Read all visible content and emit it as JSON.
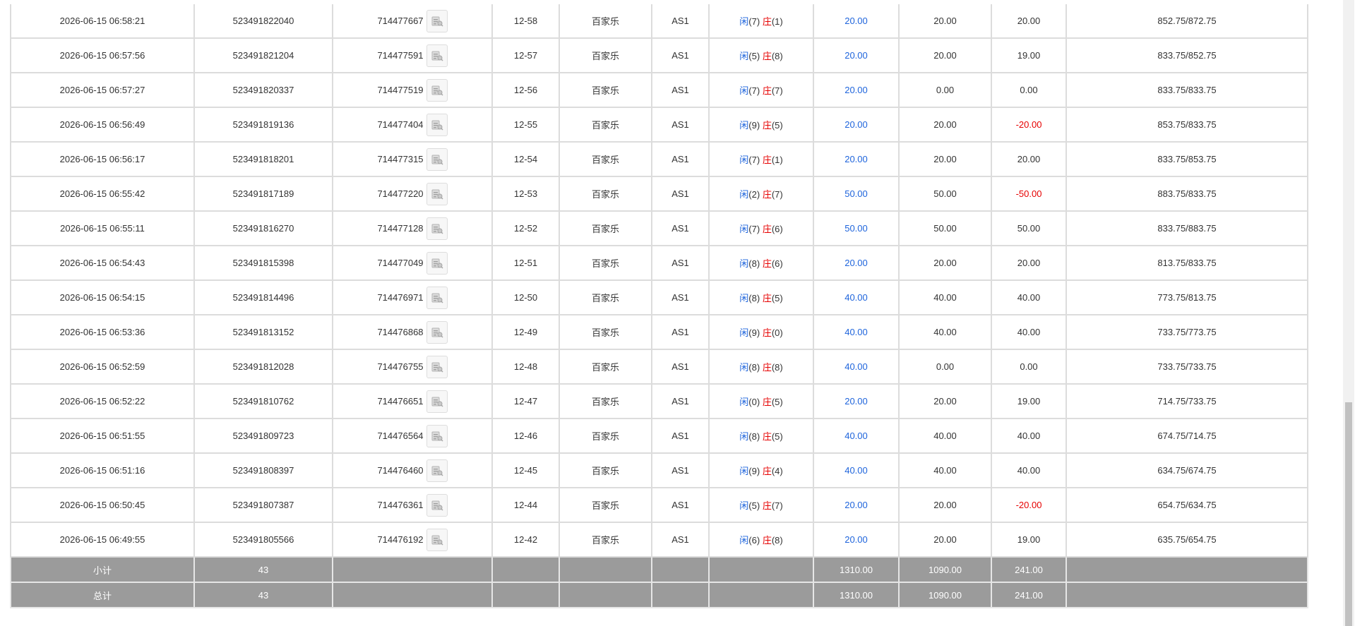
{
  "rows": [
    {
      "time": "2026-06-15 06:58:21",
      "order_no": "523491822040",
      "round_id": "714477667",
      "shoe": "12-58",
      "game": "百家乐",
      "table": "AS1",
      "result": {
        "player_label": "闲",
        "player_point": "(7)",
        "banker_label": "庄",
        "banker_point": "(1)"
      },
      "bet": "20.00",
      "valid_bet": "20.00",
      "win_loss": "20.00",
      "win_color": "normal",
      "balance": "852.75/872.75"
    },
    {
      "time": "2026-06-15 06:57:56",
      "order_no": "523491821204",
      "round_id": "714477591",
      "shoe": "12-57",
      "game": "百家乐",
      "table": "AS1",
      "result": {
        "player_label": "闲",
        "player_point": "(5)",
        "banker_label": "庄",
        "banker_point": "(8)"
      },
      "bet": "20.00",
      "valid_bet": "20.00",
      "win_loss": "19.00",
      "win_color": "normal",
      "balance": "833.75/852.75"
    },
    {
      "time": "2026-06-15 06:57:27",
      "order_no": "523491820337",
      "round_id": "714477519",
      "shoe": "12-56",
      "game": "百家乐",
      "table": "AS1",
      "result": {
        "player_label": "闲",
        "player_point": "(7)",
        "banker_label": "庄",
        "banker_point": "(7)"
      },
      "bet": "20.00",
      "valid_bet": "0.00",
      "win_loss": "0.00",
      "win_color": "normal",
      "balance": "833.75/833.75"
    },
    {
      "time": "2026-06-15 06:56:49",
      "order_no": "523491819136",
      "round_id": "714477404",
      "shoe": "12-55",
      "game": "百家乐",
      "table": "AS1",
      "result": {
        "player_label": "闲",
        "player_point": "(9)",
        "banker_label": "庄",
        "banker_point": "(5)"
      },
      "bet": "20.00",
      "valid_bet": "20.00",
      "win_loss": "-20.00",
      "win_color": "red",
      "balance": "853.75/833.75"
    },
    {
      "time": "2026-06-15 06:56:17",
      "order_no": "523491818201",
      "round_id": "714477315",
      "shoe": "12-54",
      "game": "百家乐",
      "table": "AS1",
      "result": {
        "player_label": "闲",
        "player_point": "(7)",
        "banker_label": "庄",
        "banker_point": "(1)"
      },
      "bet": "20.00",
      "valid_bet": "20.00",
      "win_loss": "20.00",
      "win_color": "normal",
      "balance": "833.75/853.75"
    },
    {
      "time": "2026-06-15 06:55:42",
      "order_no": "523491817189",
      "round_id": "714477220",
      "shoe": "12-53",
      "game": "百家乐",
      "table": "AS1",
      "result": {
        "player_label": "闲",
        "player_point": "(2)",
        "banker_label": "庄",
        "banker_point": "(7)"
      },
      "bet": "50.00",
      "valid_bet": "50.00",
      "win_loss": "-50.00",
      "win_color": "red",
      "balance": "883.75/833.75"
    },
    {
      "time": "2026-06-15 06:55:11",
      "order_no": "523491816270",
      "round_id": "714477128",
      "shoe": "12-52",
      "game": "百家乐",
      "table": "AS1",
      "result": {
        "player_label": "闲",
        "player_point": "(7)",
        "banker_label": "庄",
        "banker_point": "(6)"
      },
      "bet": "50.00",
      "valid_bet": "50.00",
      "win_loss": "50.00",
      "win_color": "normal",
      "balance": "833.75/883.75"
    },
    {
      "time": "2026-06-15 06:54:43",
      "order_no": "523491815398",
      "round_id": "714477049",
      "shoe": "12-51",
      "game": "百家乐",
      "table": "AS1",
      "result": {
        "player_label": "闲",
        "player_point": "(8)",
        "banker_label": "庄",
        "banker_point": "(6)"
      },
      "bet": "20.00",
      "valid_bet": "20.00",
      "win_loss": "20.00",
      "win_color": "normal",
      "balance": "813.75/833.75"
    },
    {
      "time": "2026-06-15 06:54:15",
      "order_no": "523491814496",
      "round_id": "714476971",
      "shoe": "12-50",
      "game": "百家乐",
      "table": "AS1",
      "result": {
        "player_label": "闲",
        "player_point": "(8)",
        "banker_label": "庄",
        "banker_point": "(5)"
      },
      "bet": "40.00",
      "valid_bet": "40.00",
      "win_loss": "40.00",
      "win_color": "normal",
      "balance": "773.75/813.75"
    },
    {
      "time": "2026-06-15 06:53:36",
      "order_no": "523491813152",
      "round_id": "714476868",
      "shoe": "12-49",
      "game": "百家乐",
      "table": "AS1",
      "result": {
        "player_label": "闲",
        "player_point": "(9)",
        "banker_label": "庄",
        "banker_point": "(0)"
      },
      "bet": "40.00",
      "valid_bet": "40.00",
      "win_loss": "40.00",
      "win_color": "normal",
      "balance": "733.75/773.75"
    },
    {
      "time": "2026-06-15 06:52:59",
      "order_no": "523491812028",
      "round_id": "714476755",
      "shoe": "12-48",
      "game": "百家乐",
      "table": "AS1",
      "result": {
        "player_label": "闲",
        "player_point": "(8)",
        "banker_label": "庄",
        "banker_point": "(8)"
      },
      "bet": "40.00",
      "valid_bet": "0.00",
      "win_loss": "0.00",
      "win_color": "normal",
      "balance": "733.75/733.75"
    },
    {
      "time": "2026-06-15 06:52:22",
      "order_no": "523491810762",
      "round_id": "714476651",
      "shoe": "12-47",
      "game": "百家乐",
      "table": "AS1",
      "result": {
        "player_label": "闲",
        "player_point": "(0)",
        "banker_label": "庄",
        "banker_point": "(5)"
      },
      "bet": "20.00",
      "valid_bet": "20.00",
      "win_loss": "19.00",
      "win_color": "normal",
      "balance": "714.75/733.75"
    },
    {
      "time": "2026-06-15 06:51:55",
      "order_no": "523491809723",
      "round_id": "714476564",
      "shoe": "12-46",
      "game": "百家乐",
      "table": "AS1",
      "result": {
        "player_label": "闲",
        "player_point": "(8)",
        "banker_label": "庄",
        "banker_point": "(5)"
      },
      "bet": "40.00",
      "valid_bet": "40.00",
      "win_loss": "40.00",
      "win_color": "normal",
      "balance": "674.75/714.75"
    },
    {
      "time": "2026-06-15 06:51:16",
      "order_no": "523491808397",
      "round_id": "714476460",
      "shoe": "12-45",
      "game": "百家乐",
      "table": "AS1",
      "result": {
        "player_label": "闲",
        "player_point": "(9)",
        "banker_label": "庄",
        "banker_point": "(4)"
      },
      "bet": "40.00",
      "valid_bet": "40.00",
      "win_loss": "40.00",
      "win_color": "normal",
      "balance": "634.75/674.75"
    },
    {
      "time": "2026-06-15 06:50:45",
      "order_no": "523491807387",
      "round_id": "714476361",
      "shoe": "12-44",
      "game": "百家乐",
      "table": "AS1",
      "result": {
        "player_label": "闲",
        "player_point": "(5)",
        "banker_label": "庄",
        "banker_point": "(7)"
      },
      "bet": "20.00",
      "valid_bet": "20.00",
      "win_loss": "-20.00",
      "win_color": "red",
      "balance": "654.75/634.75"
    },
    {
      "time": "2026-06-15 06:49:55",
      "order_no": "523491805566",
      "round_id": "714476192",
      "shoe": "12-42",
      "game": "百家乐",
      "table": "AS1",
      "result": {
        "player_label": "闲",
        "player_point": "(6)",
        "banker_label": "庄",
        "banker_point": "(8)"
      },
      "bet": "20.00",
      "valid_bet": "20.00",
      "win_loss": "19.00",
      "win_color": "normal",
      "balance": "635.75/654.75"
    }
  ],
  "summary": [
    {
      "label": "小计",
      "count": "43",
      "bet": "1310.00",
      "valid_bet": "1090.00",
      "win_loss": "241.00"
    },
    {
      "label": "总计",
      "count": "43",
      "bet": "1310.00",
      "valid_bet": "1090.00",
      "win_loss": "241.00"
    }
  ],
  "icons": {
    "details": "details-icon"
  },
  "colors": {
    "player": "#1e64dc",
    "banker": "#e60000",
    "bet": "#1e64dc",
    "loss": "#e60000",
    "summary_bg": "#9b9b9b",
    "border": "#dcdcdc"
  }
}
